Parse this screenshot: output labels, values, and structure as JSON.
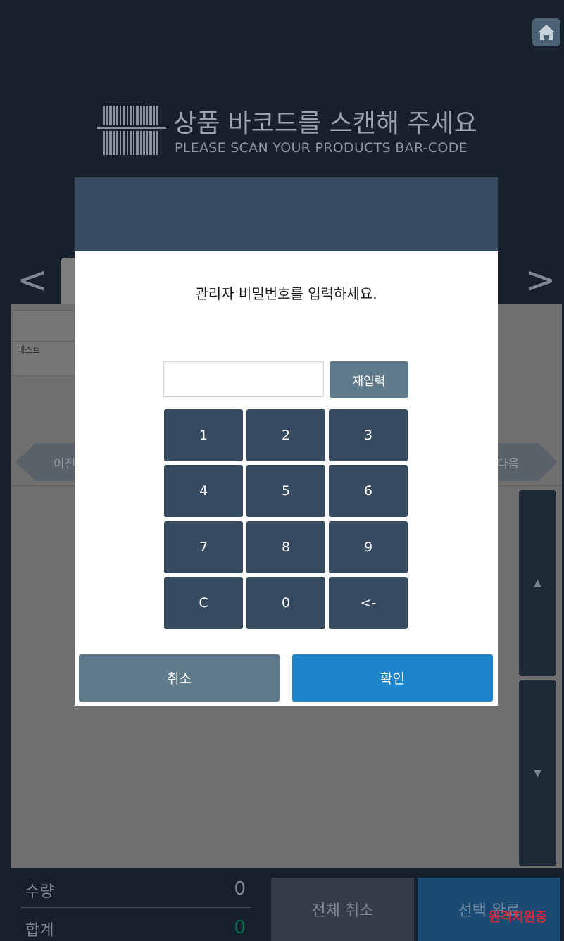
{
  "header": {
    "title_ko": "상품 바코드를 스캔해 주세요",
    "title_en": "PLEASE SCAN YOUR PRODUCTS BAR-CODE",
    "home_icon": "home-icon",
    "barcode_icon": "barcode-icon"
  },
  "carousel": {
    "prev_arrow": "<",
    "next_arrow": ">"
  },
  "product_card": {
    "label": "테스트"
  },
  "pager": {
    "prev": "이전",
    "next": "다음"
  },
  "list_scroll": {
    "up": "▲",
    "down": "▼"
  },
  "summary": {
    "qty_label": "수량",
    "qty_value": "0",
    "total_label": "합계",
    "total_value": "0"
  },
  "actions": {
    "cancel_all": "전체 취소",
    "done": "선택 완료"
  },
  "watermark": "원격지원중",
  "modal": {
    "title": "관리자 비밀번호를 입력하세요.",
    "password_value": "",
    "reenter_label": "재입력",
    "keys": [
      "1",
      "2",
      "3",
      "4",
      "5",
      "6",
      "7",
      "8",
      "9",
      "C",
      "0",
      "<-"
    ],
    "cancel_label": "취소",
    "confirm_label": "확인"
  },
  "colors": {
    "modal_header": "#364a60",
    "key_bg": "#364a60",
    "confirm": "#1e84cc",
    "secondary": "#5f7a8a"
  }
}
